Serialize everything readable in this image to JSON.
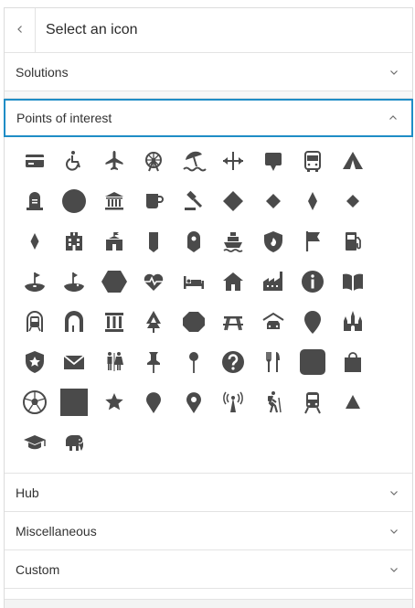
{
  "header": {
    "title": "Select an icon",
    "back_icon": "chevron-left-icon"
  },
  "sections": [
    {
      "label": "Solutions",
      "state": "collapsed"
    },
    {
      "label": "Points of interest",
      "state": "expanded"
    },
    {
      "label": "Hub",
      "state": "collapsed"
    },
    {
      "label": "Miscellaneous",
      "state": "collapsed"
    },
    {
      "label": "Custom",
      "state": "collapsed"
    }
  ],
  "accent_color": "#1f8dc6",
  "icon_color": "#4a4a4a",
  "icons": [
    "credit-card",
    "wheelchair",
    "airplane",
    "ferris-wheel",
    "beach-umbrella",
    "horizontal-arrows",
    "speech-pin",
    "bus",
    "tent",
    "gravestone",
    "circle",
    "bank",
    "coffee-cup",
    "gavel",
    "diamond-large",
    "diamond-medium",
    "diamond-tall",
    "diamond-small",
    "diamond-tall-small",
    "hospital",
    "school",
    "bookmark-pin",
    "target-pin",
    "ship",
    "fire-station",
    "flag",
    "gas-station",
    "golf",
    "mini-golf",
    "hexagon",
    "heartbeat",
    "hotel-bed",
    "house",
    "factory",
    "information",
    "library-book",
    "subway",
    "tunnel",
    "museum",
    "tree",
    "octagon",
    "picnic-table",
    "car-garage",
    "map-pin",
    "castle",
    "police-badge",
    "envelope",
    "restroom",
    "push-pin",
    "round-pin",
    "question",
    "restaurant",
    "rounded-square",
    "shopping-bag",
    "soccer-ball",
    "square",
    "star",
    "map-pin-teardrop",
    "location-pin",
    "radio-tower",
    "hiker",
    "train",
    "triangle",
    "graduation-cap",
    "elephant"
  ]
}
